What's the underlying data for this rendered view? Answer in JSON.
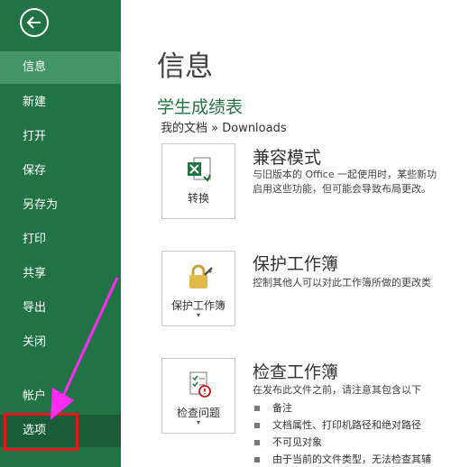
{
  "sidebar": {
    "back_icon": "back-arrow-icon",
    "items": [
      {
        "label": "信息"
      },
      {
        "label": "新建"
      },
      {
        "label": "打开"
      },
      {
        "label": "保存"
      },
      {
        "label": "另存为"
      },
      {
        "label": "打印"
      },
      {
        "label": "共享"
      },
      {
        "label": "导出"
      },
      {
        "label": "关闭"
      },
      {
        "label": "帐户"
      },
      {
        "label": "选项"
      }
    ]
  },
  "main": {
    "title": "信息",
    "doc_title": "学生成绩表",
    "path": "我的文档 » Downloads",
    "compat": {
      "button_label": "转换",
      "title": "兼容模式",
      "desc_line1": "与旧版本的 Office 一起使用时，某些新功",
      "desc_line2": "启用这些功能，但可能会导致布局更改。"
    },
    "protect": {
      "button_label": "保护工作簿",
      "caret": "▾",
      "title": "保护工作簿",
      "desc": "控制其他人可以对此工作簿所做的更改类"
    },
    "inspect": {
      "button_label": "检查问题",
      "caret": "▾",
      "title": "检查工作簿",
      "desc": "在发布此文件之前，请注意其包含以下",
      "bullets": [
        "备注",
        "文档属性、打印机路径和绝对路径",
        "不可见对象",
        "由于当前的文件类型，无法检查其辅"
      ]
    }
  },
  "colors": {
    "sidebar": "#217346",
    "active": "#439467",
    "callout": "#e8141b",
    "annotation_arrow": "#ff2bf5"
  }
}
